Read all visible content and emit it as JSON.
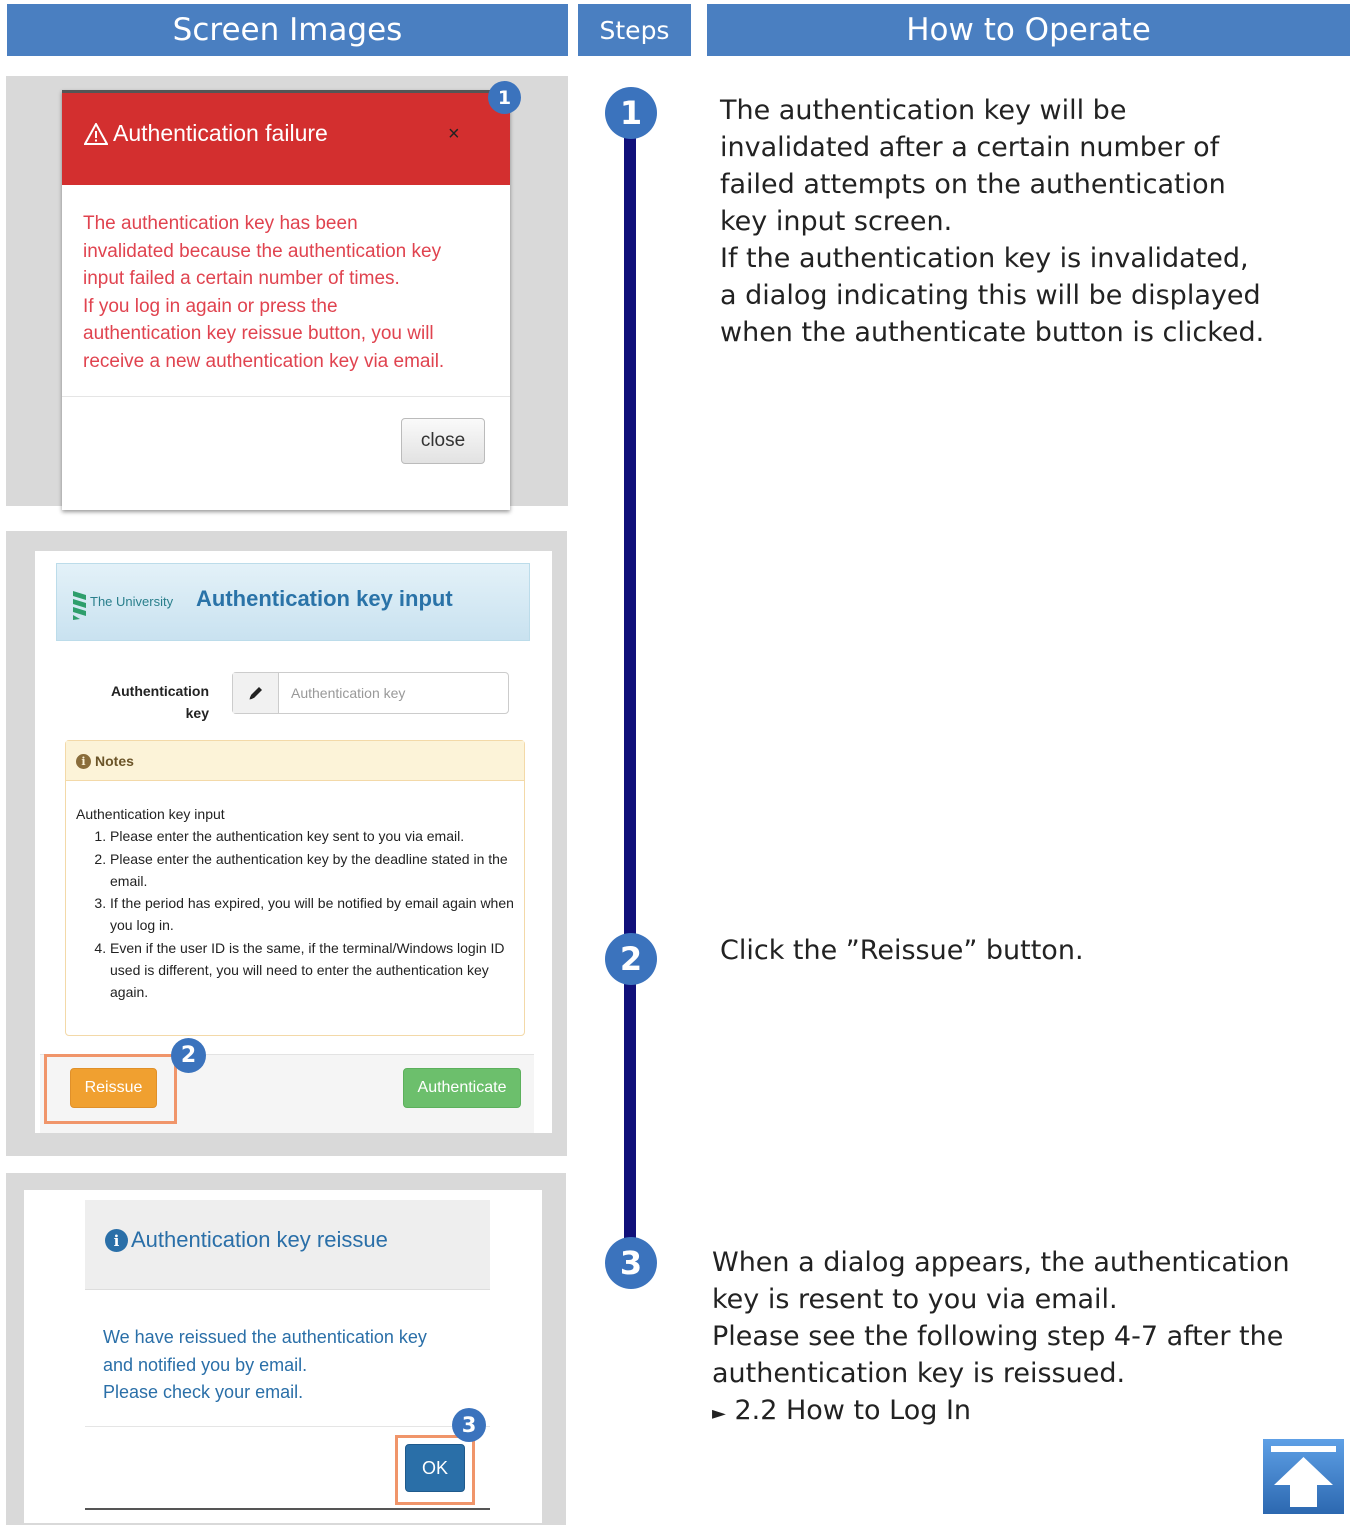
{
  "headers": {
    "screen_images": "Screen Images",
    "steps": "Steps",
    "how_to_operate": "How to Operate"
  },
  "panel1": {
    "badge": "1",
    "dialog_title": "Authentication failure",
    "close_x": "×",
    "message_lines": [
      "The authentication key has been",
      "invalidated because the authentication key",
      "input failed a certain number of times.",
      "If you log in again or press the",
      "authentication key reissue button, you will",
      "receive a new authentication key via email."
    ],
    "close_button": "close",
    "colors": {
      "header_bg": "#d32f2f",
      "message_text": "#e0434f"
    }
  },
  "panel2": {
    "logo_text": "The University",
    "page_title": "Authentication key input",
    "field_label_line1": "Authentication",
    "field_label_line2": "key",
    "input_placeholder": "Authentication key",
    "notes_title": "Notes",
    "notes_intro": "Authentication key input",
    "notes_items": [
      "Please enter the authentication key sent to you via email.",
      "Please enter the authentication key by the deadline stated in the email.",
      "If the period has expired, you will be notified by email again when you log in.",
      "Even if the user ID is the same, if the terminal/Windows login ID used is different, you will need to enter the authentication key again."
    ],
    "badge": "2",
    "reissue_button": "Reissue",
    "authenticate_button": "Authenticate",
    "colors": {
      "reissue": "#f0a030",
      "authenticate": "#6cbf6c",
      "highlight": "#f0956a"
    }
  },
  "panel3": {
    "dialog_title": "Authentication key reissue",
    "message_lines": [
      "We have reissued the authentication key",
      "and notified you by email.",
      "Please check your email."
    ],
    "badge": "3",
    "ok_button": "OK",
    "colors": {
      "message_text": "#2a6fa8",
      "ok": "#2a6fa8"
    }
  },
  "steps": [
    {
      "number": "1",
      "lines": [
        "The authentication key will be",
        "invalidated after a certain number of",
        "failed attempts on the authentication",
        "key input screen.",
        "If the authentication key is invalidated,",
        "a dialog indicating this will be displayed",
        "when the authenticate button is clicked."
      ]
    },
    {
      "number": "2",
      "lines": [
        "Click the ”Reissue” button."
      ]
    },
    {
      "number": "3",
      "lines": [
        "When a dialog appears, the authentication",
        "key is resent to you via email.",
        "Please see the following step 4-7 after the",
        "authentication key is reissued."
      ],
      "link_arrow": "►",
      "link_text": "2.2 How to Log In"
    }
  ],
  "icons": {
    "warning": "warning-icon",
    "info": "info-icon",
    "pencil": "pencil-icon",
    "back_to_top": "arrow-up-icon"
  },
  "colors": {
    "header": "#4a7fc1",
    "badge": "#3b73bd",
    "timeline": "#10107a",
    "panel_bg": "#d9d9d9"
  }
}
